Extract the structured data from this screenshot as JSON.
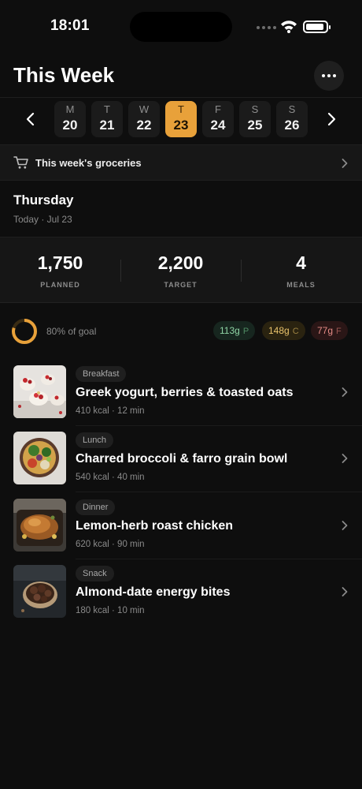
{
  "status_bar": {
    "time": "18:01"
  },
  "header": {
    "title": "This Week",
    "more_icon": "ellipsis-icon"
  },
  "week": {
    "days": [
      {
        "dow": "M",
        "num": "20"
      },
      {
        "dow": "T",
        "num": "21"
      },
      {
        "dow": "W",
        "num": "22"
      },
      {
        "dow": "T",
        "num": "23",
        "selected": true
      },
      {
        "dow": "F",
        "num": "24"
      },
      {
        "dow": "S",
        "num": "25"
      },
      {
        "dow": "S",
        "num": "26"
      }
    ]
  },
  "groceries": {
    "label": "This week's groceries",
    "icon": "cart-icon"
  },
  "day": {
    "title": "Thursday",
    "subtitle": "Today · Jul 23"
  },
  "stats": [
    {
      "value": "1,750",
      "label": "PLANNED"
    },
    {
      "value": "2,200",
      "label": "TARGET"
    },
    {
      "value": "4",
      "label": "MEALS"
    }
  ],
  "progress": {
    "goal_text": "80% of goal",
    "goal_fraction": 0.8
  },
  "macros": [
    {
      "value": "113g",
      "letter": "P"
    },
    {
      "value": "148g",
      "letter": "C"
    },
    {
      "value": "77g",
      "letter": "F"
    }
  ],
  "meals": [
    {
      "tag": "Breakfast",
      "name": "Greek yogurt, berries & toasted oats",
      "meta": "410 kcal · 12 min"
    },
    {
      "tag": "Lunch",
      "name": "Charred broccoli & farro grain bowl",
      "meta": "540 kcal · 40 min"
    },
    {
      "tag": "Dinner",
      "name": "Lemon-herb roast chicken",
      "meta": "620 kcal · 90 min"
    },
    {
      "tag": "Snack",
      "name": "Almond-date energy bites",
      "meta": "180 kcal · 10 min"
    }
  ],
  "colors": {
    "accent": "#e8a13a",
    "protein": "#8fd4a5",
    "carbs": "#e9c36b",
    "fat": "#e58a85"
  }
}
